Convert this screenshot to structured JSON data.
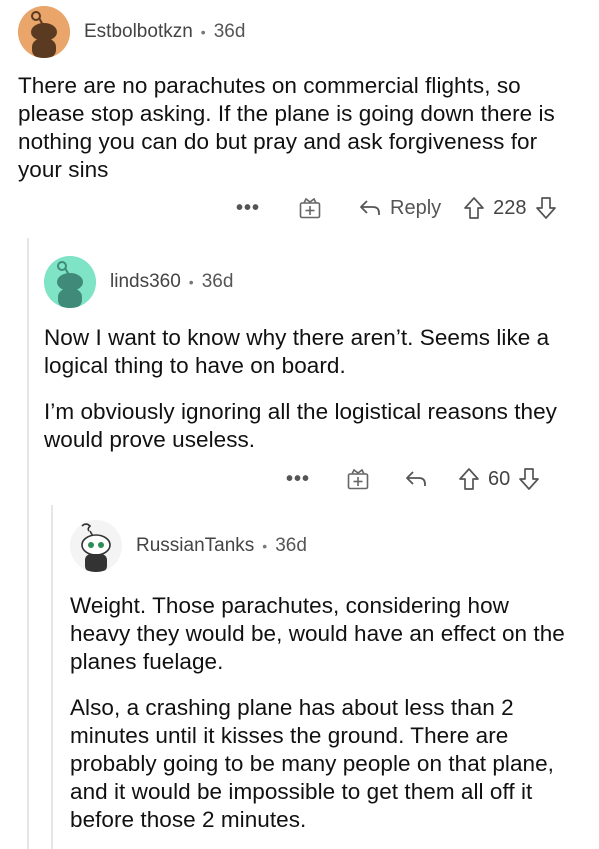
{
  "comments": [
    {
      "username": "Estbolbotkzn",
      "age": "36d",
      "paragraphs": [
        "There are no parachutes on commercial flights, so please stop asking. If the plane is going down there is nothing you can do but pray and ask forgiveness for your sins"
      ],
      "more_label": "•••",
      "reply_label": "Reply",
      "score": "228",
      "avatar_color": "#e9a56a"
    },
    {
      "username": "linds360",
      "age": "36d",
      "paragraphs": [
        "Now I want to know why there aren’t. Seems like a logical thing to have on board.",
        "I’m obviously ignoring all the logistical reasons they would prove useless."
      ],
      "more_label": "•••",
      "score": "60",
      "avatar_color": "#7fe3c6"
    },
    {
      "username": "RussianTanks",
      "age": "36d",
      "paragraphs": [
        "Weight. Those parachutes, considering how heavy they would be, would have an effect on the planes fuelage.",
        "Also, a crashing plane has about less than 2 minutes until it kisses the ground. There are probably going to be many people on that plane, and it would be impossible to get them all off it before those 2 minutes."
      ],
      "avatar_color": "#f4f4f4"
    }
  ],
  "separator": "•",
  "icons": [
    "more-icon",
    "award-icon",
    "reply-icon",
    "upvote-icon",
    "downvote-icon"
  ]
}
